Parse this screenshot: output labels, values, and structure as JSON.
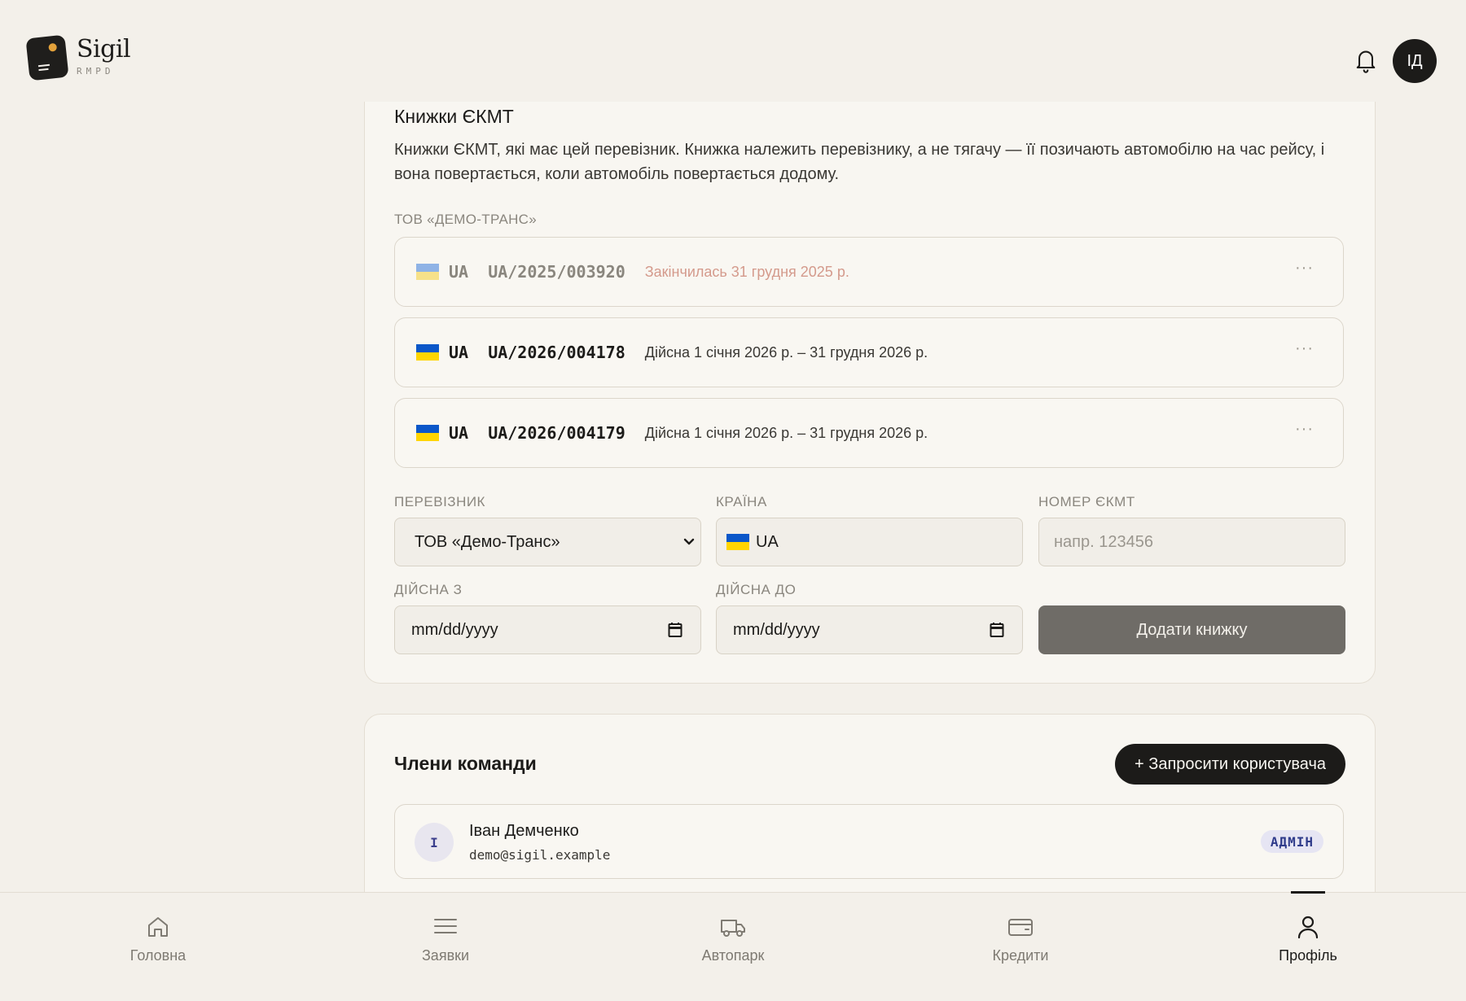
{
  "app": {
    "name": "Sigil",
    "sub": "RMPD",
    "avatar_initials": "ІД"
  },
  "ekmt": {
    "title": "Книжки ЄКМТ",
    "description": "Книжки ЄКМТ, які має цей перевізник. Книжка належить перевізнику, а не тягачу — її позичають автомобілю на час рейсу, і вона повертається, коли автомобіль повертається додому.",
    "carrier_group": "ТОВ «ДЕМО-ТРАНС»",
    "permits": [
      {
        "country": "UA",
        "number": "UA/2025/003920",
        "status": "Закінчилась 31 грудня 2025 р.",
        "expired": true
      },
      {
        "country": "UA",
        "number": "UA/2026/004178",
        "status": "Дійсна 1 січня 2026 р. – 31 грудня 2026 р.",
        "expired": false
      },
      {
        "country": "UA",
        "number": "UA/2026/004179",
        "status": "Дійсна 1 січня 2026 р. – 31 грудня 2026 р.",
        "expired": false
      }
    ],
    "more_menu": "···",
    "form": {
      "carrier_label": "ПЕРЕВІЗНИК",
      "carrier_value": "ТОВ «Демо-Транс»",
      "country_label": "КРАЇНА",
      "country_value": "UA",
      "number_label": "НОМЕР ЄКМТ",
      "number_placeholder": "напр. 123456",
      "valid_from_label": "ДІЙСНА З",
      "valid_from_value": "mm/dd/yyyy",
      "valid_to_label": "ДІЙСНА ДО",
      "valid_to_value": "mm/dd/yyyy",
      "add_button": "Додати книжку"
    }
  },
  "team": {
    "title": "Члени команди",
    "invite_button": "+ Запросити користувача",
    "members": [
      {
        "initial": "I",
        "name": "Іван Демченко",
        "email": "demo@sigil.example",
        "role": "АДМІН"
      }
    ]
  },
  "nav": {
    "items": [
      {
        "label": "Головна",
        "icon": "home-icon"
      },
      {
        "label": "Заявки",
        "icon": "list-icon"
      },
      {
        "label": "Автопарк",
        "icon": "truck-icon"
      },
      {
        "label": "Кредити",
        "icon": "card-icon"
      },
      {
        "label": "Профіль",
        "icon": "user-icon"
      }
    ],
    "active": "Профіль"
  },
  "colors": {
    "background": "#f3f0ea",
    "accent": "#1c1b19",
    "flag_blue": "#0b57c9",
    "flag_yellow": "#ffd500",
    "expired_text": "#d49a8c",
    "role_badge": "#e6e5f3"
  }
}
